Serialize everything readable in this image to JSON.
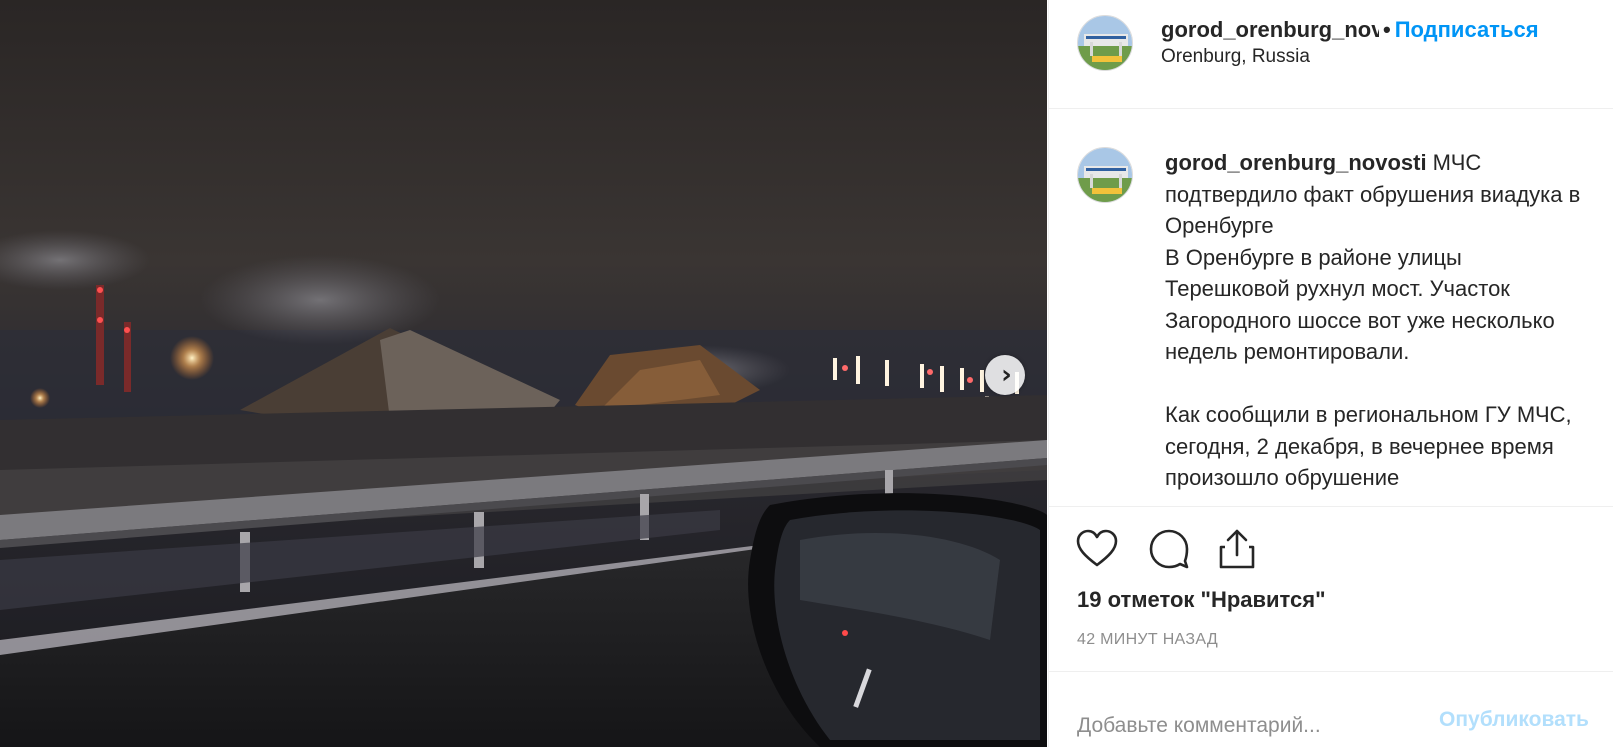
{
  "post": {
    "image_alt": "Collapsed viaduct at night in Orenburg",
    "next_icon": "chevron-right-icon"
  },
  "header": {
    "username": "gorod_orenburg_novosti",
    "separator": "•",
    "follow_label": "Подписаться",
    "location": "Orenburg, Russia"
  },
  "caption": {
    "username": "gorod_orenburg_novosti",
    "text": " МЧС подтвердило факт обрушения виадука в Оренбурге\nВ Оренбурге в районе улицы Терешковой рухнул мост. Участок Загородного шоссе вот уже несколько недель ремонтировали.\n\nКак сообщили в региональном ГУ МЧС, сегодня, 2 декабря, в вечернее время произошло обрушение"
  },
  "actions": {
    "like_icon": "heart-icon",
    "comment_icon": "comment-icon",
    "share_icon": "share-icon",
    "likes_text": "19 отметок \"Нравится\"",
    "timestamp": "42 МИНУТ НАЗАД"
  },
  "comment": {
    "placeholder": "Добавьте комментарий...",
    "publish_label": "Опубликовать"
  },
  "colors": {
    "accent": "#0095f6",
    "publish_disabled": "#b2dffc",
    "muted": "#8e8e8e",
    "divider": "#efefef"
  }
}
